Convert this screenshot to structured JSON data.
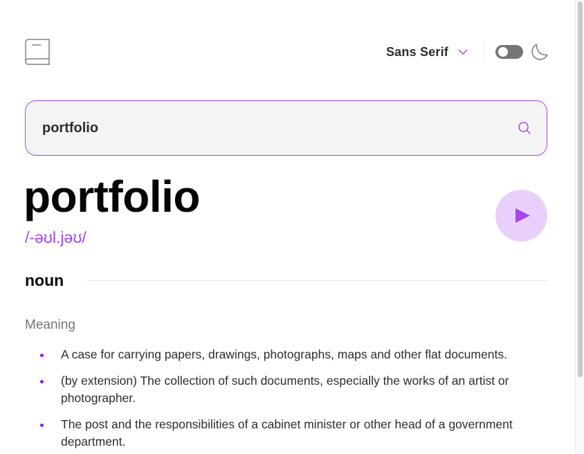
{
  "header": {
    "logo_icon": "book-icon",
    "font_selector": {
      "selected": "Sans Serif",
      "icon": "chevron-down-icon"
    },
    "theme_toggle": {
      "state": "off",
      "icon": "moon-icon"
    }
  },
  "search": {
    "value": "portfolio",
    "placeholder": "",
    "icon": "search-icon"
  },
  "entry": {
    "word": "portfolio",
    "phonetic": "/-əʊl.jəʊ/",
    "play_icon": "play-icon",
    "meanings": [
      {
        "part_of_speech": "noun",
        "heading": "Meaning",
        "definitions": [
          "A case for carrying papers, drawings, photographs, maps and other flat documents.",
          "(by extension) The collection of such documents, especially the works of an artist or photographer.",
          "The post and the responsibilities of a cabinet minister or other head of a government department."
        ]
      }
    ]
  },
  "colors": {
    "accent": "#a445ed",
    "accent_light": "#e9d0fa",
    "text": "#050505",
    "muted": "#757575",
    "input_bg": "#f4f4f4"
  }
}
